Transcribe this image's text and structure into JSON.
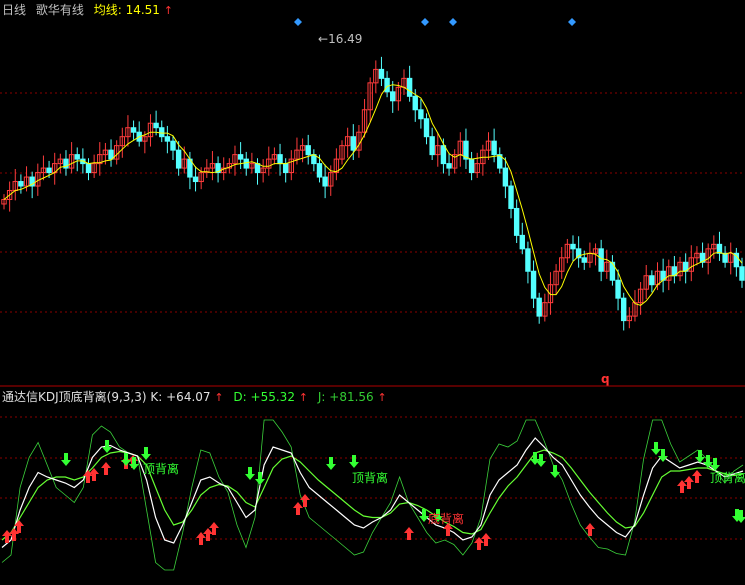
{
  "top_header": {
    "period": "日线",
    "stock_name": "歌华有线",
    "ma_label": "均线:",
    "ma_value": "14.51",
    "ma_arrow": "↑"
  },
  "price_panel": {
    "high_marker": "16.49",
    "bottom_marker": "q"
  },
  "kdj_header": {
    "title": "通达信KDJ顶底背离(9,3,3)",
    "k_label": "K:",
    "k_value": "+64.07",
    "d_label": "D:",
    "d_value": "+55.32",
    "j_label": "J:",
    "j_value": "+81.56",
    "arrow": "↑"
  },
  "kdj_annotations": [
    "顶背离",
    "顶背离",
    "顶背离",
    "底背离"
  ],
  "colors": {
    "background": "#000000",
    "up_candle": "#ff3c3c",
    "down_candle": "#54ffff",
    "ma_line": "#ffff00",
    "k_line": "#ffffff",
    "d_line": "#66ff33",
    "j_line": "#3bd13b",
    "grid": "#8a0000",
    "header_text": "#c0c0c0",
    "ma_text": "#ffff00",
    "arrow_up": "#ff3333",
    "arrow_down": "#33ff33",
    "diamond": "#3399ff"
  },
  "chart_data": {
    "type": "candlestick",
    "close_prices": [
      13.2,
      13.4,
      13.6,
      13.5,
      13.7,
      13.5,
      13.8,
      13.9,
      13.8,
      14.0,
      14.1,
      13.9,
      14.2,
      14.1,
      14.0,
      13.8,
      14.0,
      14.2,
      14.3,
      14.1,
      14.4,
      14.6,
      14.8,
      14.7,
      14.5,
      14.6,
      14.9,
      14.8,
      14.6,
      14.5,
      14.3,
      13.9,
      14.1,
      13.7,
      13.6,
      13.8,
      13.9,
      14.0,
      13.8,
      13.9,
      14.0,
      14.2,
      14.1,
      13.9,
      14.0,
      13.8,
      13.9,
      14.1,
      14.2,
      14.0,
      13.8,
      14.1,
      14.3,
      14.4,
      14.2,
      14.0,
      13.7,
      13.5,
      13.8,
      14.1,
      14.4,
      14.6,
      14.3,
      14.7,
      15.2,
      15.8,
      16.1,
      15.9,
      15.6,
      15.4,
      15.7,
      15.9,
      15.5,
      15.2,
      15.0,
      14.6,
      14.2,
      14.4,
      14.0,
      13.9,
      14.2,
      14.5,
      14.1,
      13.8,
      14.0,
      14.3,
      14.5,
      14.2,
      13.9,
      13.5,
      13.0,
      12.4,
      12.1,
      11.6,
      11.0,
      10.6,
      10.9,
      11.3,
      11.6,
      11.9,
      12.2,
      12.1,
      11.9,
      11.8,
      12.0,
      12.1,
      11.6,
      11.8,
      11.4,
      11.0,
      10.5,
      10.6,
      10.9,
      11.2,
      11.5,
      11.3,
      11.6,
      11.4,
      11.7,
      11.5,
      11.8,
      11.6,
      11.9,
      12.0,
      11.8,
      12.1,
      12.2,
      12.0,
      11.8,
      12.0,
      11.7,
      11.4
    ],
    "ma_label": "均线",
    "ma_value": 14.51,
    "high_label": 16.49,
    "k": [
      15,
      20,
      40,
      55,
      65,
      62,
      60,
      58,
      55,
      60,
      75,
      82,
      83,
      80,
      78,
      76,
      60,
      35,
      20,
      18,
      30,
      45,
      60,
      62,
      58,
      55,
      45,
      35,
      40,
      70,
      82,
      80,
      78,
      65,
      55,
      50,
      45,
      40,
      35,
      30,
      28,
      32,
      35,
      40,
      50,
      45,
      40,
      35,
      30,
      28,
      25,
      20,
      22,
      30,
      50,
      60,
      65,
      70,
      80,
      88,
      82,
      75,
      70,
      60,
      50,
      42,
      35,
      30,
      25,
      22,
      30,
      50,
      68,
      76,
      72,
      68,
      70,
      72,
      70,
      66,
      62,
      64,
      66
    ],
    "d": [
      20,
      25,
      35,
      45,
      55,
      60,
      62,
      62,
      60,
      62,
      68,
      75,
      78,
      79,
      78,
      76,
      70,
      55,
      40,
      30,
      32,
      40,
      50,
      55,
      57,
      56,
      52,
      45,
      42,
      55,
      68,
      74,
      76,
      72,
      66,
      60,
      55,
      50,
      45,
      40,
      36,
      35,
      35,
      38,
      44,
      45,
      43,
      40,
      36,
      32,
      29,
      25,
      24,
      27,
      38,
      48,
      56,
      62,
      70,
      78,
      80,
      78,
      75,
      68,
      60,
      52,
      45,
      38,
      32,
      28,
      29,
      38,
      50,
      62,
      66,
      66,
      67,
      68,
      68,
      66,
      64,
      63,
      64
    ],
    "j": [
      5,
      10,
      55,
      75,
      85,
      70,
      55,
      50,
      45,
      55,
      90,
      96,
      92,
      82,
      78,
      76,
      40,
      5,
      0,
      0,
      25,
      55,
      80,
      78,
      62,
      52,
      30,
      15,
      35,
      100,
      100,
      92,
      82,
      50,
      35,
      30,
      25,
      20,
      15,
      10,
      12,
      25,
      35,
      45,
      62,
      45,
      35,
      25,
      18,
      20,
      17,
      10,
      18,
      35,
      74,
      84,
      82,
      86,
      100,
      100,
      86,
      70,
      60,
      44,
      30,
      22,
      15,
      14,
      11,
      10,
      32,
      74,
      100,
      100,
      84,
      72,
      76,
      80,
      74,
      66,
      58,
      66,
      70
    ]
  }
}
